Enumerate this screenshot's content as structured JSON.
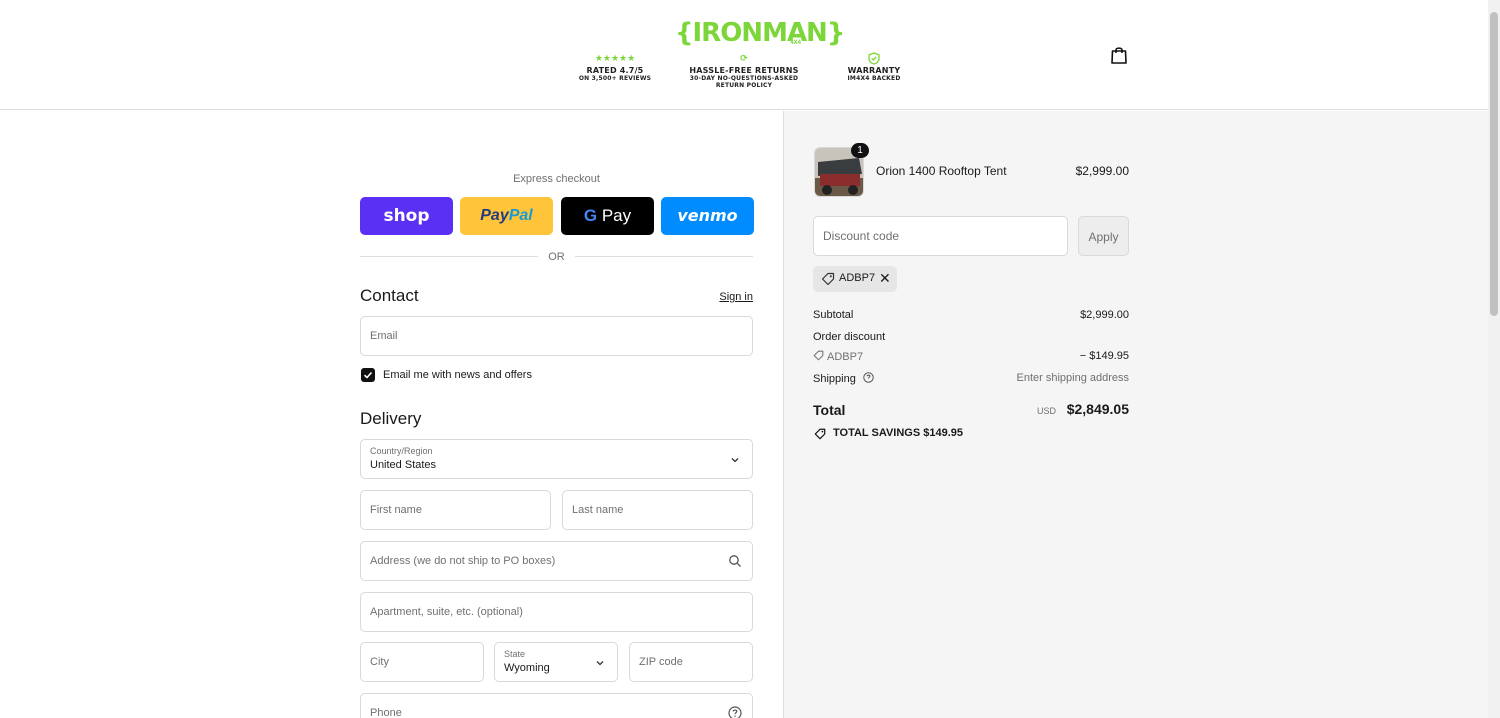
{
  "header": {
    "logo": "{IRONMAN}",
    "logo_sub": "4X4",
    "badges": [
      {
        "icon": "★★★★★",
        "title": "RATED 4.7/5",
        "sub": "ON 3,500+ REVIEWS"
      },
      {
        "icon": "⟳",
        "title": "HASSLE-FREE RETURNS",
        "sub": "30-DAY NO-QUESTIONS-ASKED",
        "sub2": "RETURN POLICY"
      },
      {
        "icon": "shield-check",
        "title": "WARRANTY",
        "sub": "IM4X4 BACKED"
      }
    ]
  },
  "express": {
    "label": "Express checkout",
    "shop": "shop",
    "paypal_a": "Pay",
    "paypal_b": "Pal",
    "gpay_g": "G",
    "gpay_pay": " Pay",
    "venmo": "venmo",
    "or": "OR"
  },
  "contact": {
    "title": "Contact",
    "sign_in": "Sign in",
    "email_placeholder": "Email",
    "newsletter_label": "Email me with news and offers",
    "newsletter_checked": true
  },
  "delivery": {
    "title": "Delivery",
    "country_label": "Country/Region",
    "country_value": "United States",
    "first_name": "First name",
    "last_name": "Last name",
    "address": "Address (we do not ship to PO boxes)",
    "apartment": "Apartment, suite, etc. (optional)",
    "city": "City",
    "state_label": "State",
    "state_value": "Wyoming",
    "zip": "ZIP code",
    "phone": "Phone"
  },
  "summary": {
    "item": {
      "name": "Orion 1400 Rooftop Tent",
      "price": "$2,999.00",
      "qty": "1"
    },
    "discount_placeholder": "Discount code",
    "apply": "Apply",
    "applied_code": "ADBP7",
    "subtotal_label": "Subtotal",
    "subtotal_value": "$2,999.00",
    "order_discount_label": "Order discount",
    "discount_code": "ADBP7",
    "discount_value": "− $149.95",
    "shipping_label": "Shipping",
    "shipping_value": "Enter shipping address",
    "total_label": "Total",
    "currency": "USD",
    "total_value": "$2,849.05",
    "savings": "TOTAL SAVINGS  $149.95"
  },
  "colors": {
    "brand": "#7cd63a",
    "shop": "#5a31f4",
    "paypal": "#ffc439",
    "venmo": "#008cff"
  }
}
